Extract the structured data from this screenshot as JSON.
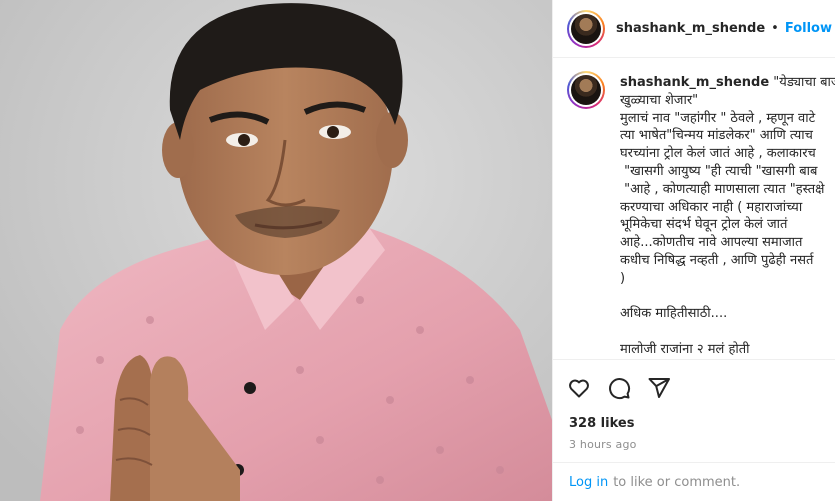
{
  "post": {
    "photo_alt": "man in pink shirt with folded hands",
    "colors": {
      "shirt": "#e9a9b4",
      "skin": "#b07c5a",
      "hair": "#1f1b18",
      "background": "#cccccc"
    }
  },
  "header": {
    "username": "shashank_m_shende",
    "separator": "•",
    "follow_label": "Follow",
    "follow_color": "#0095f6"
  },
  "caption": {
    "username": "shashank_m_shende",
    "first_line": " \"येड्याचा बाजार",
    "lines": [
      "खुळ्याचा शेजार\"",
      "मुलाचं नाव \"जहांगीर \" ठेवले , म्हणून वाटे",
      "त्या भाषेत\"चिन्मय मांडलेकर\" आणि त्याच",
      "घरच्यांना ट्रोल केलं जातं आहे , कलाकारच",
      " \"खासगी आयुष्य \"ही त्याची \"खासगी बाब",
      " \"आहे , कोणत्याही माणसाला त्यात \"हस्तक्षे",
      "करण्याचा अधिकार नाही ( महाराजांच्या",
      "भूमिकेचा संदर्भ घेवून ट्रोल केलं जातं",
      "आहे...कोणतीच नावे आपल्या समाजात",
      "कधीच निषिद्ध नव्हती , आणि पुढेही नसर्त",
      ")",
      "",
      "अधिक माहितीसाठी....",
      "",
      "मालोजी राजांना २ मलं होती"
    ]
  },
  "actions": {
    "icons": [
      "heart-icon",
      "comment-icon",
      "share-icon"
    ],
    "likes": "328 likes",
    "time": "3 hours ago"
  },
  "login": {
    "link_text": "Log in",
    "rest_text": "to like or comment."
  }
}
